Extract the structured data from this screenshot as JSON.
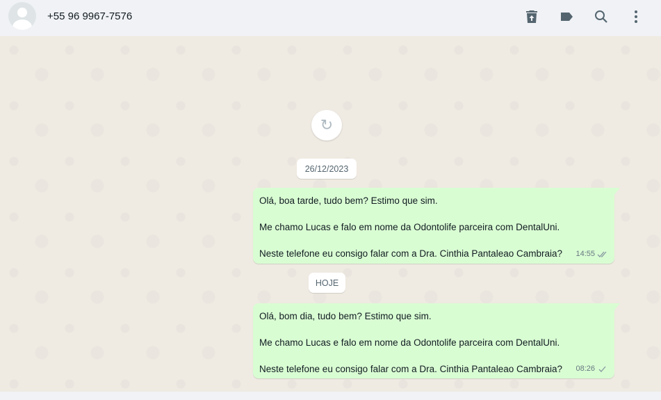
{
  "header": {
    "contact": "+55 96 9967-7576",
    "icons": [
      "delete-icon",
      "label-icon",
      "search-icon",
      "menu-icon"
    ]
  },
  "chat": {
    "dates": [
      "26/12/2023",
      "HOJE"
    ],
    "messages": [
      {
        "lines": [
          "Olá, boa tarde, tudo bem? Estimo que sim.",
          "",
          "Me chamo Lucas e falo em nome da Odontolife parceira com DentalUni.",
          "",
          "Neste telefone eu consigo falar com a Dra. Cinthia Pantaleao Cambraia?"
        ],
        "time": "14:55",
        "status": "double-check"
      },
      {
        "lines": [
          "Olá, bom dia, tudo bem? Estimo que sim.",
          "",
          "Me chamo Lucas e falo em nome da Odontolife parceira com DentalUni.",
          "",
          "Neste telefone eu consigo falar com a Dra. Cinthia Pantaleao Cambraia?"
        ],
        "time": "08:26",
        "status": "single-check"
      }
    ]
  }
}
